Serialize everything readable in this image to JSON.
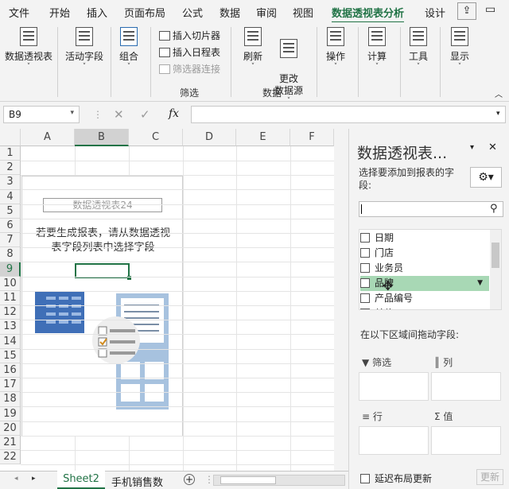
{
  "menu": {
    "tabs": [
      {
        "label": "文件",
        "key": "file"
      },
      {
        "label": "开始",
        "key": "home"
      },
      {
        "label": "插入",
        "key": "insert"
      },
      {
        "label": "页面布局",
        "key": "layout"
      },
      {
        "label": "公式",
        "key": "formulas"
      },
      {
        "label": "数据",
        "key": "data"
      },
      {
        "label": "审阅",
        "key": "review"
      },
      {
        "label": "视图",
        "key": "view"
      },
      {
        "label": "数据透视表分析",
        "key": "pivot-analyze"
      },
      {
        "label": "设计",
        "key": "design"
      }
    ],
    "active": "数据透视表分析"
  },
  "ribbon": {
    "pivottable": "数据透视表",
    "active_field": "活动字段",
    "group": "组合",
    "insert_slicer": "插入切片器",
    "insert_timeline": "插入日程表",
    "filter_connections": "筛选器连接",
    "filter_group": "筛选",
    "refresh": "刷新",
    "change_source": "更改\n数据源",
    "data_group": "数据",
    "actions": "操作",
    "calculations": "计算",
    "tools": "工具",
    "show": "显示"
  },
  "formula_bar": {
    "name_box": "B9",
    "fx": "fx",
    "value": ""
  },
  "grid": {
    "columns": [
      "A",
      "B",
      "C",
      "D",
      "E",
      "F"
    ],
    "rows": [
      "1",
      "2",
      "3",
      "4",
      "5",
      "6",
      "7",
      "8",
      "9",
      "10",
      "11",
      "12",
      "13",
      "14",
      "15",
      "16",
      "17",
      "18",
      "19",
      "20",
      "21",
      "22"
    ],
    "selected_cell": "B9"
  },
  "pivot_placeholder": {
    "name": "数据透视表24",
    "message_line1": "若要生成报表，请从数据透视",
    "message_line2": "表字段列表中选择字段"
  },
  "panel": {
    "title": "数据透视表...",
    "prompt": "选择要添加到报表的字段:",
    "search_placeholder": "",
    "fields": [
      {
        "label": "日期",
        "checked": false
      },
      {
        "label": "门店",
        "checked": false
      },
      {
        "label": "业务员",
        "checked": false
      },
      {
        "label": "品牌",
        "checked": false,
        "highlighted": true
      },
      {
        "label": "产品编号",
        "checked": false
      },
      {
        "label": "单价",
        "checked": false
      }
    ],
    "drag_prompt": "在以下区域间拖动字段:",
    "zones": {
      "filters": "筛选",
      "columns": "列",
      "rows": "行",
      "values": "值"
    },
    "defer_label": "延迟布局更新",
    "update_button": "更新"
  },
  "sheets": {
    "tabs": [
      "Sheet2",
      "手机销售数"
    ],
    "active": "Sheet2"
  },
  "colors": {
    "accent": "#217346",
    "field_highlight": "#a8d8b5"
  }
}
